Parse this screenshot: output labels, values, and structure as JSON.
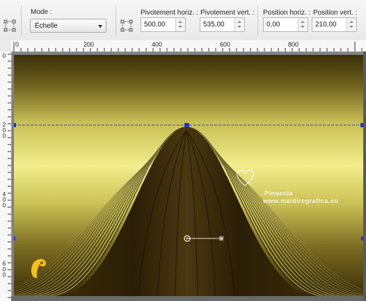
{
  "toolbar": {
    "mode_label": "Mode :",
    "mode_value": "Échelle",
    "pivot_h_label": "Pivotement horiz. :",
    "pivot_h_value": "500,00",
    "pivot_v_label": "Pivotement vert. :",
    "pivot_v_value": "535,00",
    "pos_h_label": "Position horiz. :",
    "pos_h_value": "0,00",
    "pos_v_label": "Position vert. :",
    "pos_v_value": "210,00"
  },
  "ruler_top": [
    "0",
    "200",
    "400",
    "600",
    "800"
  ],
  "ruler_left": [
    [
      "0"
    ],
    [
      "2",
      "0",
      "0"
    ],
    [
      "4",
      "0",
      "0"
    ],
    [
      "6",
      "0",
      "0"
    ]
  ],
  "watermark": {
    "line1": "Pinuccia",
    "line2": "www.maidiregrafica.eu"
  },
  "colors": {
    "handle_blue": "#2233cc",
    "guide_blue": "#3344cc",
    "accent_yellow": "#e8e07a"
  }
}
